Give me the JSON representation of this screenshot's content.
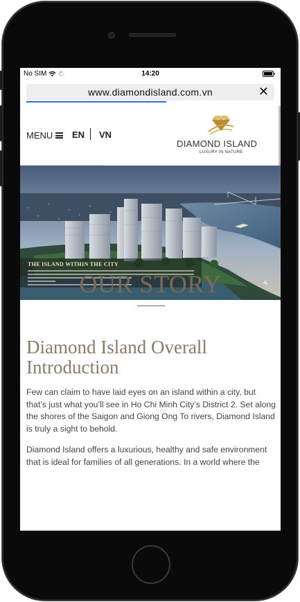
{
  "status_bar": {
    "carrier": "No SIM",
    "time": "14:20"
  },
  "browser": {
    "url": "www.diamondisland.com.vn",
    "close_glyph": "✕"
  },
  "header": {
    "menu_label": "MENU",
    "languages": [
      "EN",
      "VN"
    ],
    "logo": {
      "name": "DIAMOND ISLAND",
      "tagline": "LUXURY IN NATURE"
    }
  },
  "hero": {
    "caption_title": "THE ISLAND WITHIN THE CITY"
  },
  "story": {
    "title": "OUR STORY",
    "intro_title": "Diamond Island Overall Introduction",
    "paragraphs": [
      "Few can claim to have laid eyes on an island within a city, but that’s just what you’ll see in Ho Chi Minh City’s District 2. Set along the shores of the Saigon and Giong Ong To rivers, Diamond Island is truly a sight to behold.",
      "Diamond Island offers a luxurious, healthy and safe environment that is ideal for families of all generations. In a world where the"
    ]
  },
  "colors": {
    "brand_gold": "#c9a24a",
    "heading_brown": "#7a6b58",
    "progress_blue": "#2f6fe0"
  },
  "icons": [
    "wifi-icon",
    "loading-spinner-icon",
    "battery-icon",
    "close-icon",
    "hamburger-icon",
    "diamond-logo-icon"
  ]
}
